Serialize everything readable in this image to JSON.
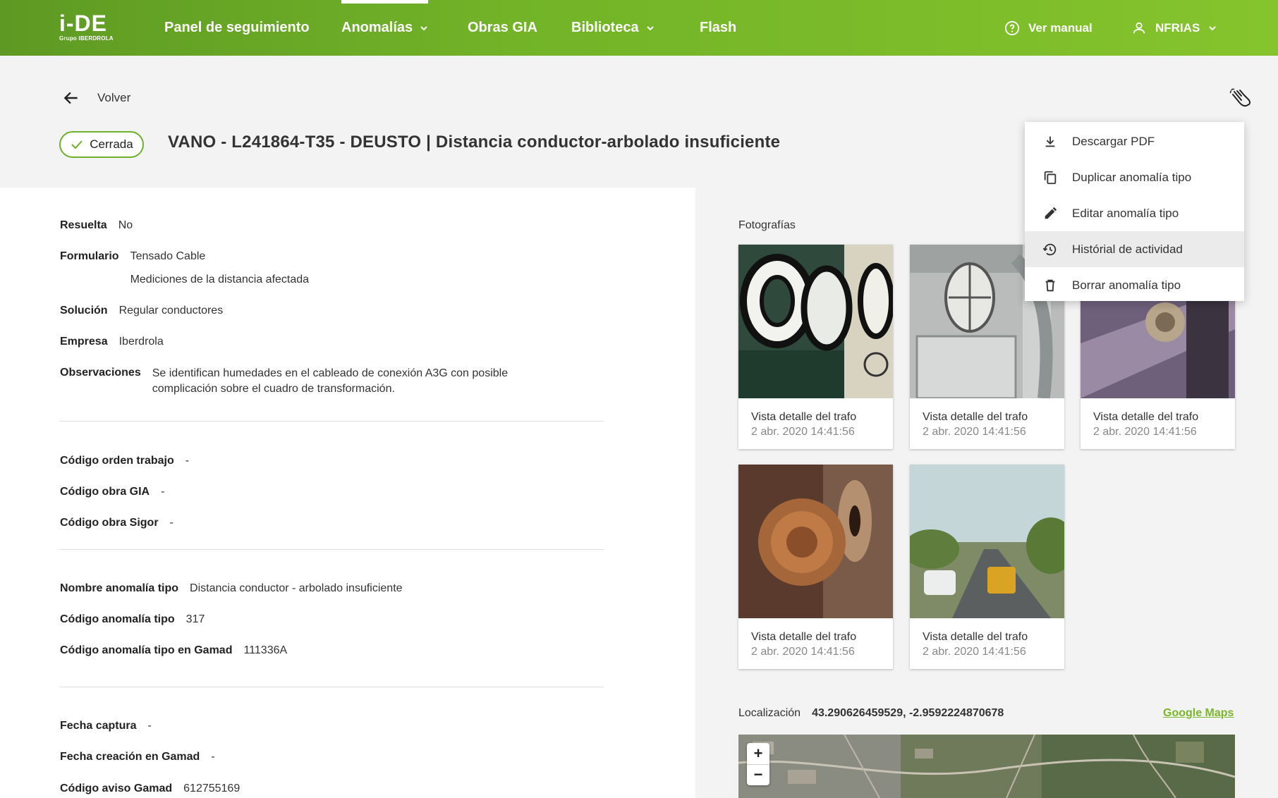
{
  "brand": {
    "logo_main": "i-DE",
    "logo_sub": "Grupo IBERDROLA"
  },
  "nav": {
    "items": [
      {
        "label": "Panel de seguimiento",
        "has_dropdown": false,
        "active": false
      },
      {
        "label": "Anomalías",
        "has_dropdown": true,
        "active": true
      },
      {
        "label": "Obras GIA",
        "has_dropdown": false,
        "active": false
      },
      {
        "label": "Biblioteca",
        "has_dropdown": true,
        "active": false
      },
      {
        "label": "Flash",
        "has_dropdown": false,
        "active": false
      }
    ],
    "manual_label": "Ver manual",
    "user_label": "NFRIAS"
  },
  "header": {
    "back_label": "Volver",
    "status": "Cerrada",
    "title": "VANO - L241864-T35 - DEUSTO | Distancia conductor-arbolado insuficiente"
  },
  "details": {
    "resuelta": {
      "label": "Resuelta",
      "value": "No"
    },
    "formulario": {
      "label": "Formulario",
      "value1": "Tensado Cable",
      "value2": "Mediciones de la distancia afectada"
    },
    "solucion": {
      "label": "Solución",
      "value": "Regular conductores"
    },
    "empresa": {
      "label": "Empresa",
      "value": "Iberdrola"
    },
    "observaciones": {
      "label": "Observaciones",
      "line1": "Se identifican humedades en el cableado de conexión A3G con posible",
      "line2": "complicación sobre el cuadro de transformación."
    },
    "codigo_orden": {
      "label": "Código orden trabajo",
      "value": "-"
    },
    "codigo_gia": {
      "label": "Código obra GIA",
      "value": "-"
    },
    "codigo_sigor": {
      "label": "Código obra Sigor",
      "value": "-"
    },
    "nombre_tipo": {
      "label": "Nombre anomalía tipo",
      "value": "Distancia conductor - arbolado insuficiente"
    },
    "codigo_tipo": {
      "label": "Código anomalía tipo",
      "value": "317"
    },
    "codigo_gamad": {
      "label": "Código anomalía tipo en Gamad",
      "value": "111336A"
    },
    "fecha_captura": {
      "label": "Fecha captura",
      "value": "-"
    },
    "fecha_creacion": {
      "label": "Fecha creación en Gamad",
      "value": "-"
    },
    "codigo_aviso": {
      "label": "Código aviso Gamad",
      "value": "612755169"
    }
  },
  "photos": {
    "section_label": "Fotografías",
    "items": [
      {
        "title": "Vista detalle del trafo",
        "date": "2 abr. 2020 14:41:56"
      },
      {
        "title": "Vista detalle del trafo",
        "date": "2 abr. 2020 14:41:56"
      },
      {
        "title": "Vista detalle del trafo",
        "date": "2 abr. 2020 14:41:56"
      },
      {
        "title": "Vista detalle del trafo",
        "date": "2 abr. 2020 14:41:56"
      },
      {
        "title": "Vista detalle del trafo",
        "date": "2 abr. 2020 14:41:56"
      }
    ]
  },
  "location": {
    "label": "Localización",
    "coords": "43.290626459529, -2.9592224870678",
    "gmaps_label": "Google Maps",
    "zoom_in": "+",
    "zoom_out": "−"
  },
  "menu": {
    "items": [
      {
        "label": "Descargar PDF",
        "icon": "download-icon"
      },
      {
        "label": "Duplicar anomalía tipo",
        "icon": "copy-icon"
      },
      {
        "label": "Editar anomalía tipo",
        "icon": "pencil-icon"
      },
      {
        "label": "Histórial de actividad",
        "icon": "history-icon",
        "highlighted": true
      },
      {
        "label": "Borrar anomalía tipo",
        "icon": "trash-icon"
      }
    ]
  },
  "colors": {
    "brand_green": "#72b328",
    "accent_green": "#6cb02c",
    "link_green": "#7ab629"
  }
}
